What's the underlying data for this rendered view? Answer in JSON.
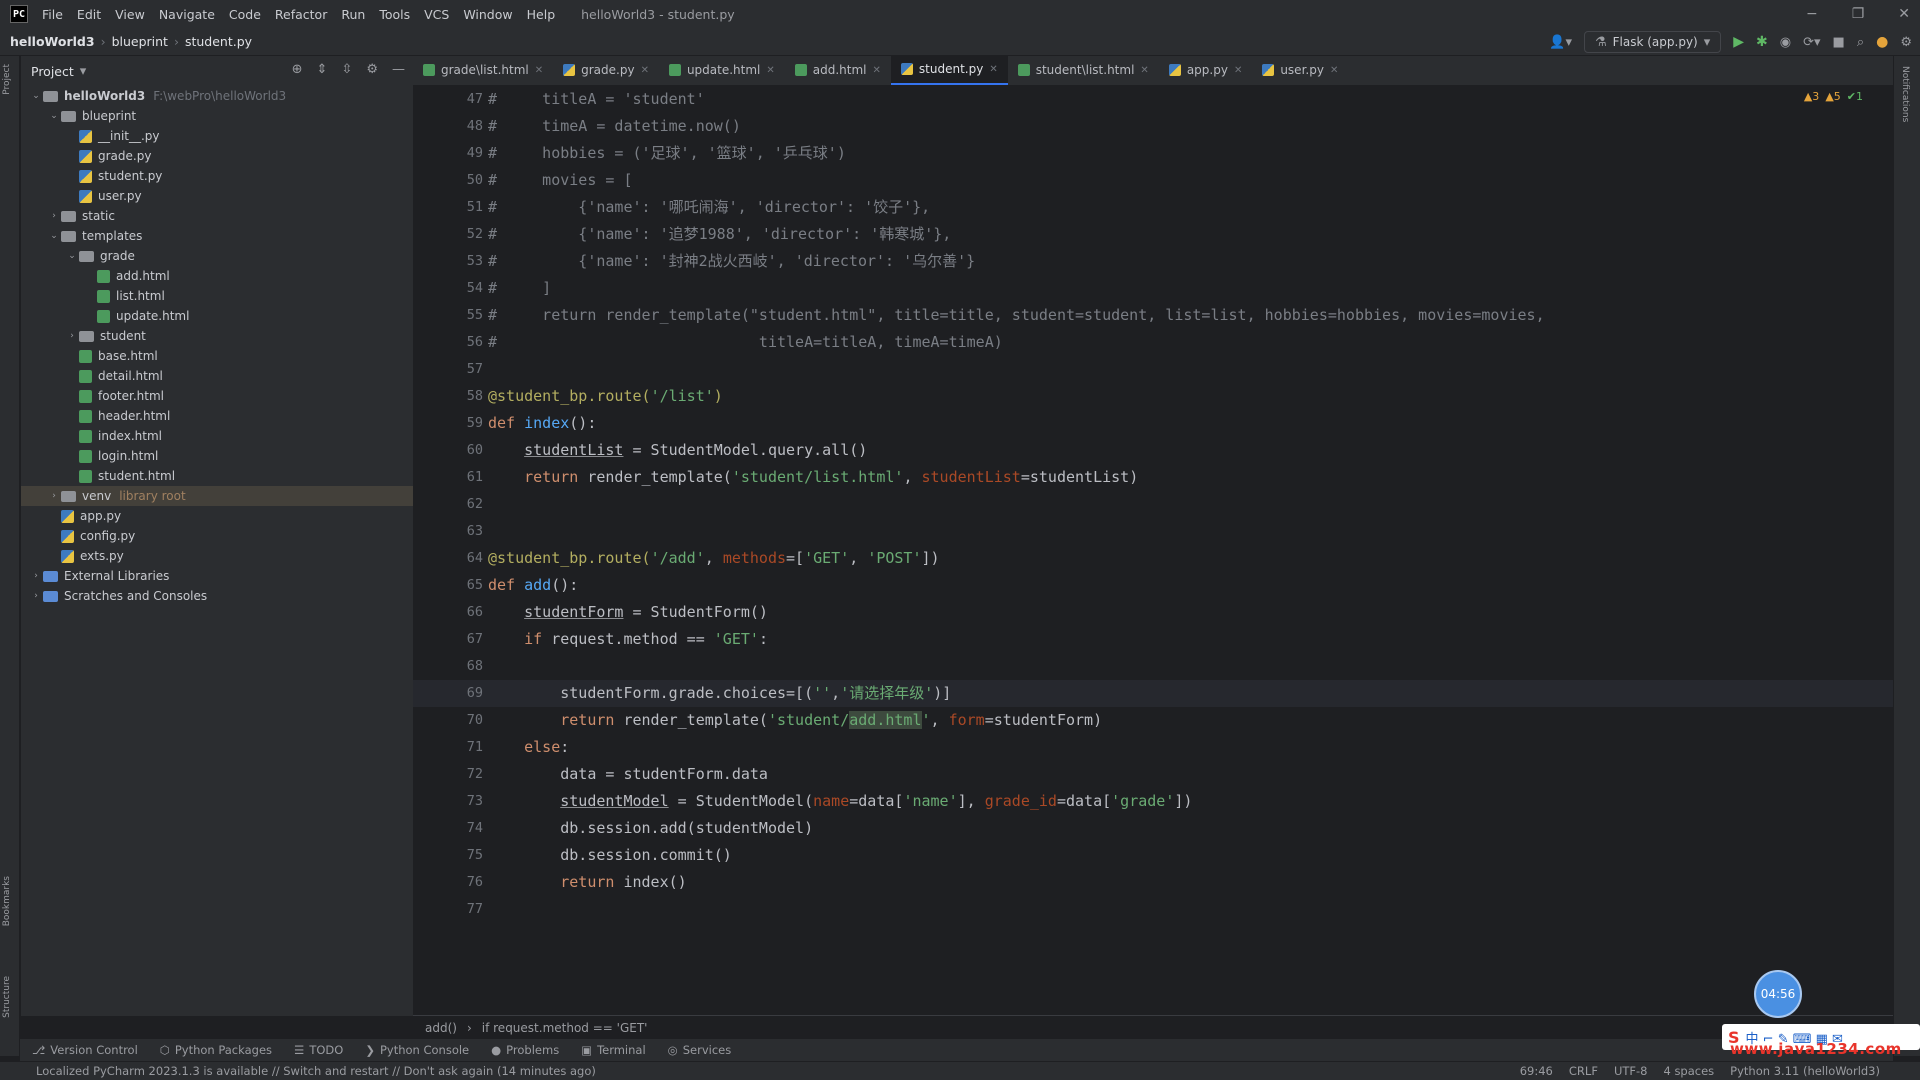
{
  "menubar": {
    "logo": "PC",
    "items": [
      "File",
      "Edit",
      "View",
      "Navigate",
      "Code",
      "Refactor",
      "Run",
      "Tools",
      "VCS",
      "Window",
      "Help"
    ],
    "title": "helloWorld3 - student.py",
    "controls": [
      "−",
      "❐",
      "✕"
    ]
  },
  "navbar": {
    "project": "helloWorld3",
    "folder": "blueprint",
    "file": "student.py",
    "run_config": "Flask (app.py)"
  },
  "project_panel": {
    "title": "Project",
    "tree": [
      {
        "indent": 0,
        "chev": "⌄",
        "icon": "folder",
        "label": "helloWorld3",
        "extra": "F:\\webPro\\helloWorld3",
        "bold": true
      },
      {
        "indent": 1,
        "chev": "⌄",
        "icon": "folder",
        "label": "blueprint"
      },
      {
        "indent": 2,
        "chev": "",
        "icon": "py",
        "label": "__init__.py"
      },
      {
        "indent": 2,
        "chev": "",
        "icon": "py",
        "label": "grade.py"
      },
      {
        "indent": 2,
        "chev": "",
        "icon": "py",
        "label": "student.py"
      },
      {
        "indent": 2,
        "chev": "",
        "icon": "py",
        "label": "user.py"
      },
      {
        "indent": 1,
        "chev": "›",
        "icon": "folder",
        "label": "static"
      },
      {
        "indent": 1,
        "chev": "⌄",
        "icon": "folder",
        "label": "templates"
      },
      {
        "indent": 2,
        "chev": "⌄",
        "icon": "folder",
        "label": "grade"
      },
      {
        "indent": 3,
        "chev": "",
        "icon": "html",
        "label": "add.html"
      },
      {
        "indent": 3,
        "chev": "",
        "icon": "html",
        "label": "list.html"
      },
      {
        "indent": 3,
        "chev": "",
        "icon": "html",
        "label": "update.html"
      },
      {
        "indent": 2,
        "chev": "›",
        "icon": "folder",
        "label": "student"
      },
      {
        "indent": 2,
        "chev": "",
        "icon": "html",
        "label": "base.html"
      },
      {
        "indent": 2,
        "chev": "",
        "icon": "html",
        "label": "detail.html"
      },
      {
        "indent": 2,
        "chev": "",
        "icon": "html",
        "label": "footer.html"
      },
      {
        "indent": 2,
        "chev": "",
        "icon": "html",
        "label": "header.html"
      },
      {
        "indent": 2,
        "chev": "",
        "icon": "html",
        "label": "index.html"
      },
      {
        "indent": 2,
        "chev": "",
        "icon": "html",
        "label": "login.html"
      },
      {
        "indent": 2,
        "chev": "",
        "icon": "html",
        "label": "student.html"
      },
      {
        "indent": 1,
        "chev": "›",
        "icon": "folder",
        "label": "venv",
        "extra": "library root",
        "selected": true
      },
      {
        "indent": 1,
        "chev": "",
        "icon": "py",
        "label": "app.py"
      },
      {
        "indent": 1,
        "chev": "",
        "icon": "py",
        "label": "config.py"
      },
      {
        "indent": 1,
        "chev": "",
        "icon": "py",
        "label": "exts.py"
      },
      {
        "indent": 0,
        "chev": "›",
        "icon": "lib",
        "label": "External Libraries"
      },
      {
        "indent": 0,
        "chev": "›",
        "icon": "lib",
        "label": "Scratches and Consoles"
      }
    ]
  },
  "tabs": [
    {
      "label": "grade\\list.html",
      "type": "html"
    },
    {
      "label": "grade.py",
      "type": "py"
    },
    {
      "label": "update.html",
      "type": "html"
    },
    {
      "label": "add.html",
      "type": "html"
    },
    {
      "label": "student.py",
      "type": "py",
      "active": true
    },
    {
      "label": "student\\list.html",
      "type": "html"
    },
    {
      "label": "app.py",
      "type": "py"
    },
    {
      "label": "user.py",
      "type": "py"
    }
  ],
  "inspections": {
    "warnings": "▲3",
    "weak": "▲5",
    "ok": "✔1"
  },
  "code": {
    "current_line": 69,
    "lines": [
      {
        "n": 47,
        "t": [
          [
            "c-comment",
            "#     titleA = 'student'"
          ]
        ]
      },
      {
        "n": 48,
        "t": [
          [
            "c-comment",
            "#     timeA = datetime.now()"
          ]
        ]
      },
      {
        "n": 49,
        "t": [
          [
            "c-comment",
            "#     hobbies = ('足球', '篮球', '乒乓球')"
          ]
        ]
      },
      {
        "n": 50,
        "t": [
          [
            "c-comment",
            "#     movies = ["
          ]
        ]
      },
      {
        "n": 51,
        "t": [
          [
            "c-comment",
            "#         {'name': '哪吒闹海', 'director': '饺子'},"
          ]
        ]
      },
      {
        "n": 52,
        "t": [
          [
            "c-comment",
            "#         {'name': '追梦1988', 'director': '韩寒城'},"
          ]
        ]
      },
      {
        "n": 53,
        "t": [
          [
            "c-comment",
            "#         {'name': '封神2战火西岐', 'director': '乌尔善'}"
          ]
        ]
      },
      {
        "n": 54,
        "t": [
          [
            "c-comment",
            "#     ]"
          ]
        ]
      },
      {
        "n": 55,
        "t": [
          [
            "c-comment",
            "#     return render_template(\"student.html\", title=title, student=student, list=list, hobbies=hobbies, movies=movies,"
          ]
        ]
      },
      {
        "n": 56,
        "t": [
          [
            "c-comment",
            "#                             titleA=titleA, timeA=timeA)"
          ]
        ]
      },
      {
        "n": 57,
        "t": []
      },
      {
        "n": 58,
        "t": [
          [
            "c-dec",
            "@student_bp.route("
          ],
          [
            "c-str",
            "'/list'"
          ],
          [
            "c-dec",
            ")"
          ]
        ]
      },
      {
        "n": 59,
        "t": [
          [
            "c-kw",
            "def "
          ],
          [
            "c-fn",
            "index"
          ],
          [
            "",
            "():"
          ]
        ]
      },
      {
        "n": 60,
        "t": [
          [
            "",
            "    "
          ],
          [
            "c-ul",
            "studentList"
          ],
          [
            "",
            " = StudentModel.query.all()"
          ]
        ]
      },
      {
        "n": 61,
        "t": [
          [
            "",
            "    "
          ],
          [
            "c-kw",
            "return "
          ],
          [
            "",
            "render_template("
          ],
          [
            "c-str",
            "'student/list.html'"
          ],
          [
            "",
            ", "
          ],
          [
            "c-param",
            "studentList"
          ],
          [
            "",
            "=studentList)"
          ]
        ]
      },
      {
        "n": 62,
        "t": []
      },
      {
        "n": 63,
        "t": []
      },
      {
        "n": 64,
        "t": [
          [
            "c-dec",
            "@student_bp.route("
          ],
          [
            "c-str",
            "'/add'"
          ],
          [
            "",
            ", "
          ],
          [
            "c-param",
            "methods"
          ],
          [
            "",
            "=["
          ],
          [
            "c-str",
            "'GET'"
          ],
          [
            "",
            ", "
          ],
          [
            "c-str",
            "'POST'"
          ],
          [
            "",
            "])"
          ]
        ]
      },
      {
        "n": 65,
        "t": [
          [
            "c-kw",
            "def "
          ],
          [
            "c-fn",
            "add"
          ],
          [
            "",
            "():"
          ]
        ]
      },
      {
        "n": 66,
        "t": [
          [
            "",
            "    "
          ],
          [
            "c-ul",
            "studentForm"
          ],
          [
            "",
            " = StudentForm()"
          ]
        ]
      },
      {
        "n": 67,
        "t": [
          [
            "",
            "    "
          ],
          [
            "c-kw",
            "if "
          ],
          [
            "",
            "request.method == "
          ],
          [
            "c-str",
            "'GET'"
          ],
          [
            "",
            ":"
          ]
        ]
      },
      {
        "n": 68,
        "t": []
      },
      {
        "n": 69,
        "t": [
          [
            "",
            "        studentForm.grade.choices=[("
          ],
          [
            "c-str",
            "''"
          ],
          [
            "",
            ","
          ],
          [
            "c-str",
            "'请选择年级'"
          ],
          [
            "",
            ")]"
          ]
        ]
      },
      {
        "n": 70,
        "t": [
          [
            "",
            "        "
          ],
          [
            "c-kw",
            "return "
          ],
          [
            "",
            "render_template("
          ],
          [
            "c-str",
            "'student/"
          ],
          [
            "c-str hl-occ",
            "add.html"
          ],
          [
            "c-str",
            "'"
          ],
          [
            "",
            ", "
          ],
          [
            "c-param",
            "form"
          ],
          [
            "",
            "=studentForm)"
          ]
        ]
      },
      {
        "n": 71,
        "t": [
          [
            "",
            "    "
          ],
          [
            "c-kw",
            "else"
          ],
          [
            "",
            ":"
          ]
        ]
      },
      {
        "n": 72,
        "t": [
          [
            "",
            "        data = studentForm.data"
          ]
        ]
      },
      {
        "n": 73,
        "t": [
          [
            "",
            "        "
          ],
          [
            "c-ul",
            "studentModel"
          ],
          [
            "",
            " = StudentModel("
          ],
          [
            "c-param",
            "name"
          ],
          [
            "",
            "=data["
          ],
          [
            "c-str",
            "'name'"
          ],
          [
            "",
            "], "
          ],
          [
            "c-param",
            "grade_id"
          ],
          [
            "",
            "=data["
          ],
          [
            "c-str",
            "'grade'"
          ],
          [
            "",
            "])"
          ]
        ]
      },
      {
        "n": 74,
        "t": [
          [
            "",
            "        db.session.add(studentModel)"
          ]
        ]
      },
      {
        "n": 75,
        "t": [
          [
            "",
            "        db.session.commit()"
          ]
        ]
      },
      {
        "n": 76,
        "t": [
          [
            "",
            "        "
          ],
          [
            "c-kw",
            "return "
          ],
          [
            "",
            "index()"
          ]
        ]
      },
      {
        "n": 77,
        "t": []
      }
    ]
  },
  "breadcrumb": {
    "func": "add()",
    "stmt": "if request.method == 'GET'"
  },
  "toolwindows": [
    "Version Control",
    "Python Packages",
    "TODO",
    "Python Console",
    "Problems",
    "Terminal",
    "Services"
  ],
  "status": {
    "message": "Localized PyCharm 2023.1.3 is available // Switch and restart // Don't ask again (14 minutes ago)",
    "position": "69:46",
    "line_sep": "CRLF",
    "encoding": "UTF-8",
    "indent": "4 spaces",
    "interpreter": "Python 3.11 (helloWorld3)"
  },
  "overlay": {
    "timer": "04:56",
    "ime": "中 ⌐ ✎ ⌨ ▦ ✉",
    "watermark": "www.java1234.com"
  }
}
